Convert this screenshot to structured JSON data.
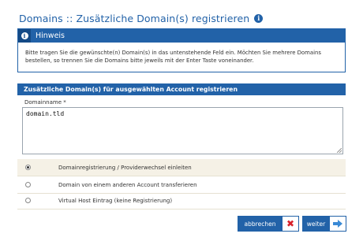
{
  "page": {
    "title": "Domains :: Zusätzliche Domain(s) registrieren",
    "info_glyph": "i"
  },
  "hint": {
    "heading": "Hinweis",
    "icon": "info-icon",
    "text": "Bitte tragen Sie die gewünschte(n) Domain(s) in das untenstehende Feld ein. Möchten Sie mehrere Domains bestellen, so trennen Sie die Domains bitte jeweils mit der Enter Taste voneinander."
  },
  "form": {
    "section_heading": "Zusätzliche Domain(s) für ausgewählten Account registrieren",
    "domain_label": "Domainname *",
    "domain_value": "domain.tld",
    "options": [
      {
        "label": "Domainregistrierung / Providerwechsel einleiten",
        "selected": true
      },
      {
        "label": "Domain von einem anderen Account transferieren",
        "selected": false
      },
      {
        "label": "Virtual Host Eintrag (keine Registrierung)",
        "selected": false
      }
    ]
  },
  "buttons": {
    "cancel_label": "abbrechen",
    "cancel_icon": "close-icon",
    "next_label": "weiter",
    "next_icon": "arrow-right-icon"
  },
  "colors": {
    "primary": "#2262a8",
    "cancel_icon": "#d8212a",
    "selected_row_bg": "#f5f1e6"
  }
}
